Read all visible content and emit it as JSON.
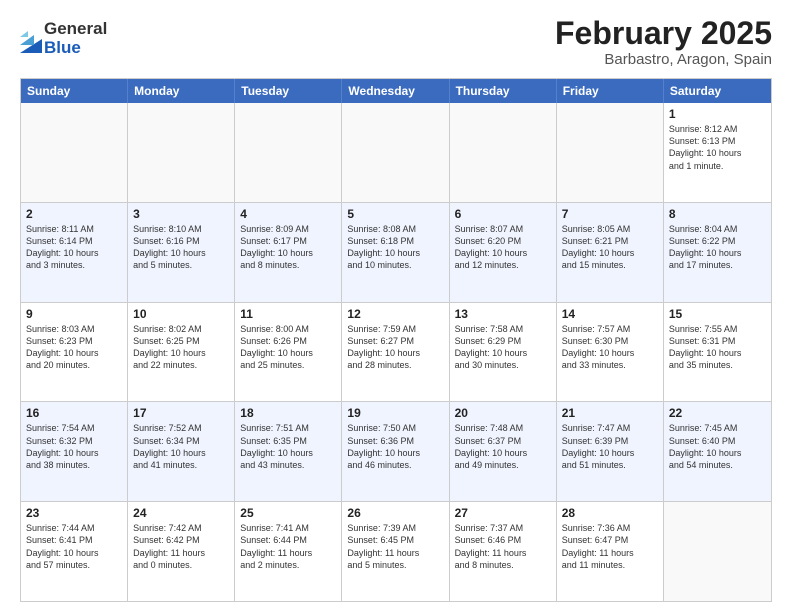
{
  "logo": {
    "general": "General",
    "blue": "Blue"
  },
  "title": {
    "month_year": "February 2025",
    "location": "Barbastro, Aragon, Spain"
  },
  "calendar": {
    "headers": [
      "Sunday",
      "Monday",
      "Tuesday",
      "Wednesday",
      "Thursday",
      "Friday",
      "Saturday"
    ],
    "rows": [
      [
        {
          "day": "",
          "info": "",
          "empty": true
        },
        {
          "day": "",
          "info": "",
          "empty": true
        },
        {
          "day": "",
          "info": "",
          "empty": true
        },
        {
          "day": "",
          "info": "",
          "empty": true
        },
        {
          "day": "",
          "info": "",
          "empty": true
        },
        {
          "day": "",
          "info": "",
          "empty": true
        },
        {
          "day": "1",
          "info": "Sunrise: 8:12 AM\nSunset: 6:13 PM\nDaylight: 10 hours\nand 1 minute.",
          "empty": false
        }
      ],
      [
        {
          "day": "2",
          "info": "Sunrise: 8:11 AM\nSunset: 6:14 PM\nDaylight: 10 hours\nand 3 minutes.",
          "empty": false
        },
        {
          "day": "3",
          "info": "Sunrise: 8:10 AM\nSunset: 6:16 PM\nDaylight: 10 hours\nand 5 minutes.",
          "empty": false
        },
        {
          "day": "4",
          "info": "Sunrise: 8:09 AM\nSunset: 6:17 PM\nDaylight: 10 hours\nand 8 minutes.",
          "empty": false
        },
        {
          "day": "5",
          "info": "Sunrise: 8:08 AM\nSunset: 6:18 PM\nDaylight: 10 hours\nand 10 minutes.",
          "empty": false
        },
        {
          "day": "6",
          "info": "Sunrise: 8:07 AM\nSunset: 6:20 PM\nDaylight: 10 hours\nand 12 minutes.",
          "empty": false
        },
        {
          "day": "7",
          "info": "Sunrise: 8:05 AM\nSunset: 6:21 PM\nDaylight: 10 hours\nand 15 minutes.",
          "empty": false
        },
        {
          "day": "8",
          "info": "Sunrise: 8:04 AM\nSunset: 6:22 PM\nDaylight: 10 hours\nand 17 minutes.",
          "empty": false
        }
      ],
      [
        {
          "day": "9",
          "info": "Sunrise: 8:03 AM\nSunset: 6:23 PM\nDaylight: 10 hours\nand 20 minutes.",
          "empty": false
        },
        {
          "day": "10",
          "info": "Sunrise: 8:02 AM\nSunset: 6:25 PM\nDaylight: 10 hours\nand 22 minutes.",
          "empty": false
        },
        {
          "day": "11",
          "info": "Sunrise: 8:00 AM\nSunset: 6:26 PM\nDaylight: 10 hours\nand 25 minutes.",
          "empty": false
        },
        {
          "day": "12",
          "info": "Sunrise: 7:59 AM\nSunset: 6:27 PM\nDaylight: 10 hours\nand 28 minutes.",
          "empty": false
        },
        {
          "day": "13",
          "info": "Sunrise: 7:58 AM\nSunset: 6:29 PM\nDaylight: 10 hours\nand 30 minutes.",
          "empty": false
        },
        {
          "day": "14",
          "info": "Sunrise: 7:57 AM\nSunset: 6:30 PM\nDaylight: 10 hours\nand 33 minutes.",
          "empty": false
        },
        {
          "day": "15",
          "info": "Sunrise: 7:55 AM\nSunset: 6:31 PM\nDaylight: 10 hours\nand 35 minutes.",
          "empty": false
        }
      ],
      [
        {
          "day": "16",
          "info": "Sunrise: 7:54 AM\nSunset: 6:32 PM\nDaylight: 10 hours\nand 38 minutes.",
          "empty": false
        },
        {
          "day": "17",
          "info": "Sunrise: 7:52 AM\nSunset: 6:34 PM\nDaylight: 10 hours\nand 41 minutes.",
          "empty": false
        },
        {
          "day": "18",
          "info": "Sunrise: 7:51 AM\nSunset: 6:35 PM\nDaylight: 10 hours\nand 43 minutes.",
          "empty": false
        },
        {
          "day": "19",
          "info": "Sunrise: 7:50 AM\nSunset: 6:36 PM\nDaylight: 10 hours\nand 46 minutes.",
          "empty": false
        },
        {
          "day": "20",
          "info": "Sunrise: 7:48 AM\nSunset: 6:37 PM\nDaylight: 10 hours\nand 49 minutes.",
          "empty": false
        },
        {
          "day": "21",
          "info": "Sunrise: 7:47 AM\nSunset: 6:39 PM\nDaylight: 10 hours\nand 51 minutes.",
          "empty": false
        },
        {
          "day": "22",
          "info": "Sunrise: 7:45 AM\nSunset: 6:40 PM\nDaylight: 10 hours\nand 54 minutes.",
          "empty": false
        }
      ],
      [
        {
          "day": "23",
          "info": "Sunrise: 7:44 AM\nSunset: 6:41 PM\nDaylight: 10 hours\nand 57 minutes.",
          "empty": false
        },
        {
          "day": "24",
          "info": "Sunrise: 7:42 AM\nSunset: 6:42 PM\nDaylight: 11 hours\nand 0 minutes.",
          "empty": false
        },
        {
          "day": "25",
          "info": "Sunrise: 7:41 AM\nSunset: 6:44 PM\nDaylight: 11 hours\nand 2 minutes.",
          "empty": false
        },
        {
          "day": "26",
          "info": "Sunrise: 7:39 AM\nSunset: 6:45 PM\nDaylight: 11 hours\nand 5 minutes.",
          "empty": false
        },
        {
          "day": "27",
          "info": "Sunrise: 7:37 AM\nSunset: 6:46 PM\nDaylight: 11 hours\nand 8 minutes.",
          "empty": false
        },
        {
          "day": "28",
          "info": "Sunrise: 7:36 AM\nSunset: 6:47 PM\nDaylight: 11 hours\nand 11 minutes.",
          "empty": false
        },
        {
          "day": "",
          "info": "",
          "empty": true
        }
      ]
    ]
  }
}
